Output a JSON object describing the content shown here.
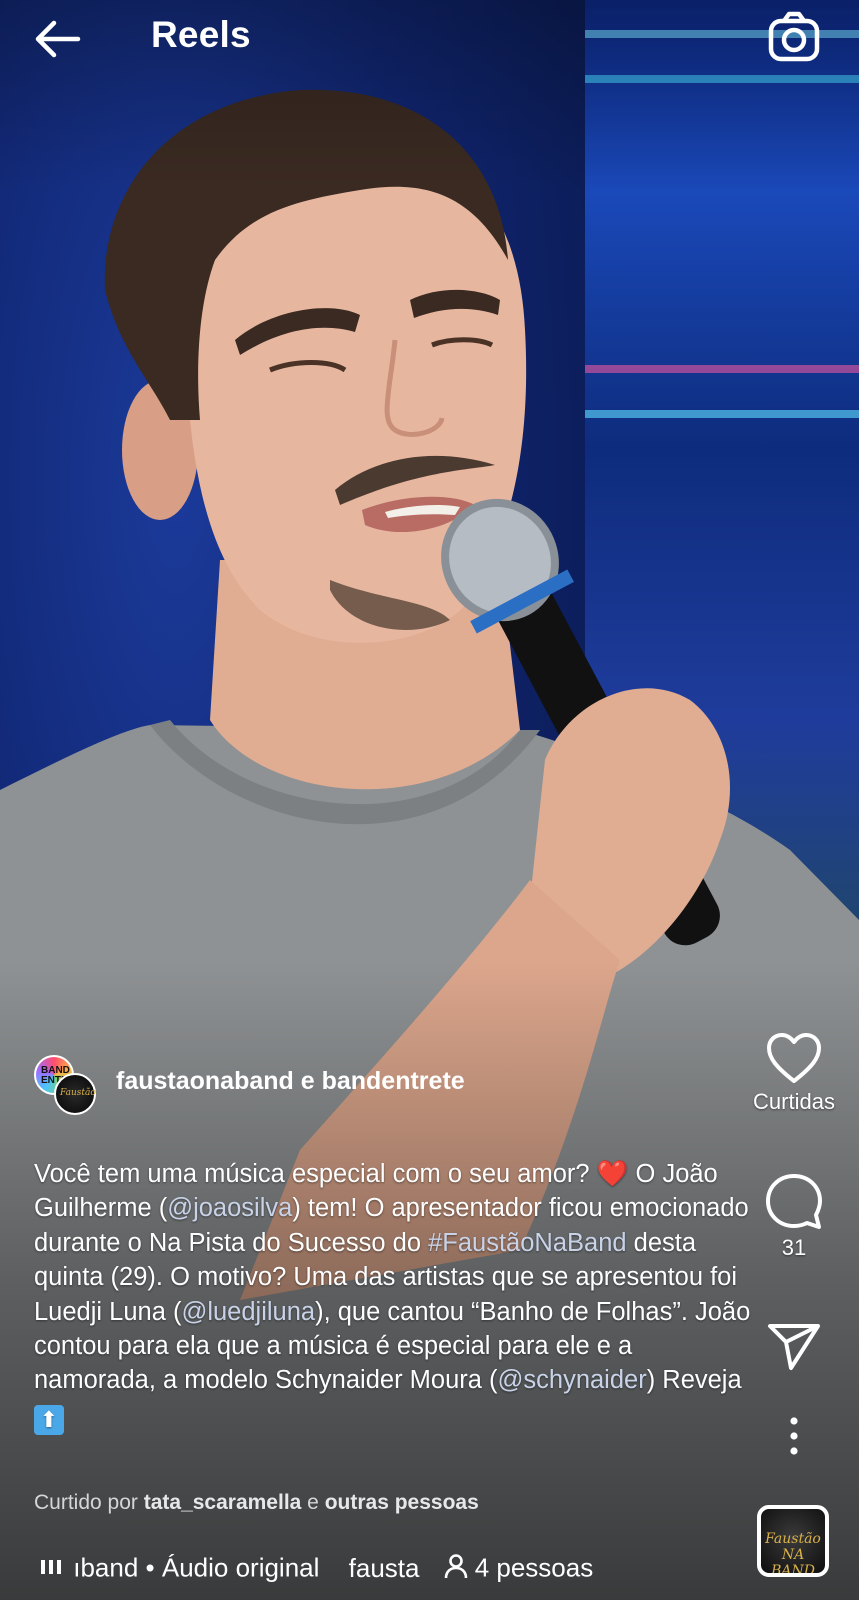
{
  "header": {
    "title": "Reels"
  },
  "author": {
    "names": "faustaonaband e bandentrete",
    "avatar1_text": "BAND ENTRE",
    "avatar2_text": "Faustão"
  },
  "caption": {
    "part1": "Você tem uma música especial com o seu amor? ",
    "part2": " O João Guilherme (",
    "mention1": "@joaosilva",
    "part3": ") tem! O apresentador ficou emocionado durante o Na Pista do Sucesso do ",
    "hashtag": "#FaustãoNaBand",
    "part4": " desta quinta (29). O motivo? Uma das artistas que se apresentou foi Luedji Luna (",
    "mention2": "@luedjiluna",
    "part5": "), que cantou “Banho de Folhas”. João contou para ela que a música é especial para ele e a namorada, a modelo Schynaider Moura (",
    "mention3": "@schynaider",
    "part6": ") Reveja ",
    "heart": "❤️",
    "up_arrow": "⬆"
  },
  "liked_by": {
    "prefix": "Curtido por ",
    "user": "tata_scaramella",
    "joiner": " e ",
    "others": "outras pessoas"
  },
  "actions": {
    "like_label": "Curtidas",
    "comment_count": "31"
  },
  "audio": {
    "name": "ıband • Áudio original",
    "extra": "fausta",
    "people": "4 pessoas",
    "thumb_text": "Faustão NA BAND"
  },
  "icons": [
    "back-arrow-icon",
    "camera-icon",
    "heart-icon",
    "comment-icon",
    "share-icon",
    "more-icon",
    "audio-bars-icon",
    "person-icon"
  ]
}
